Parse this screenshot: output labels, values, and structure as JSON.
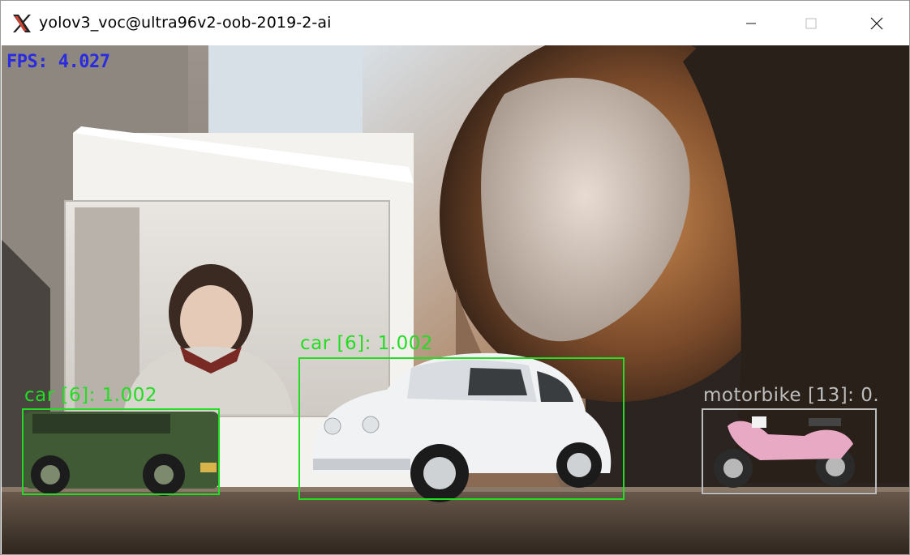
{
  "window": {
    "title": "yolov3_voc@ultra96v2-oob-2019-2-ai",
    "icon": "x11-app-icon",
    "controls": [
      "minimize-icon",
      "maximize-icon",
      "close-icon"
    ]
  },
  "overlay": {
    "fps_text": "FPS: 4.027",
    "fps_color": "#2a2ae0"
  },
  "detections": [
    {
      "label": "car [6]: 1.002",
      "color": "#22dd22"
    },
    {
      "label": "car [6]: 1.002",
      "color": "#22dd22"
    },
    {
      "label": "motorbike [13]: 0.",
      "color": "#bdbdbd"
    }
  ]
}
